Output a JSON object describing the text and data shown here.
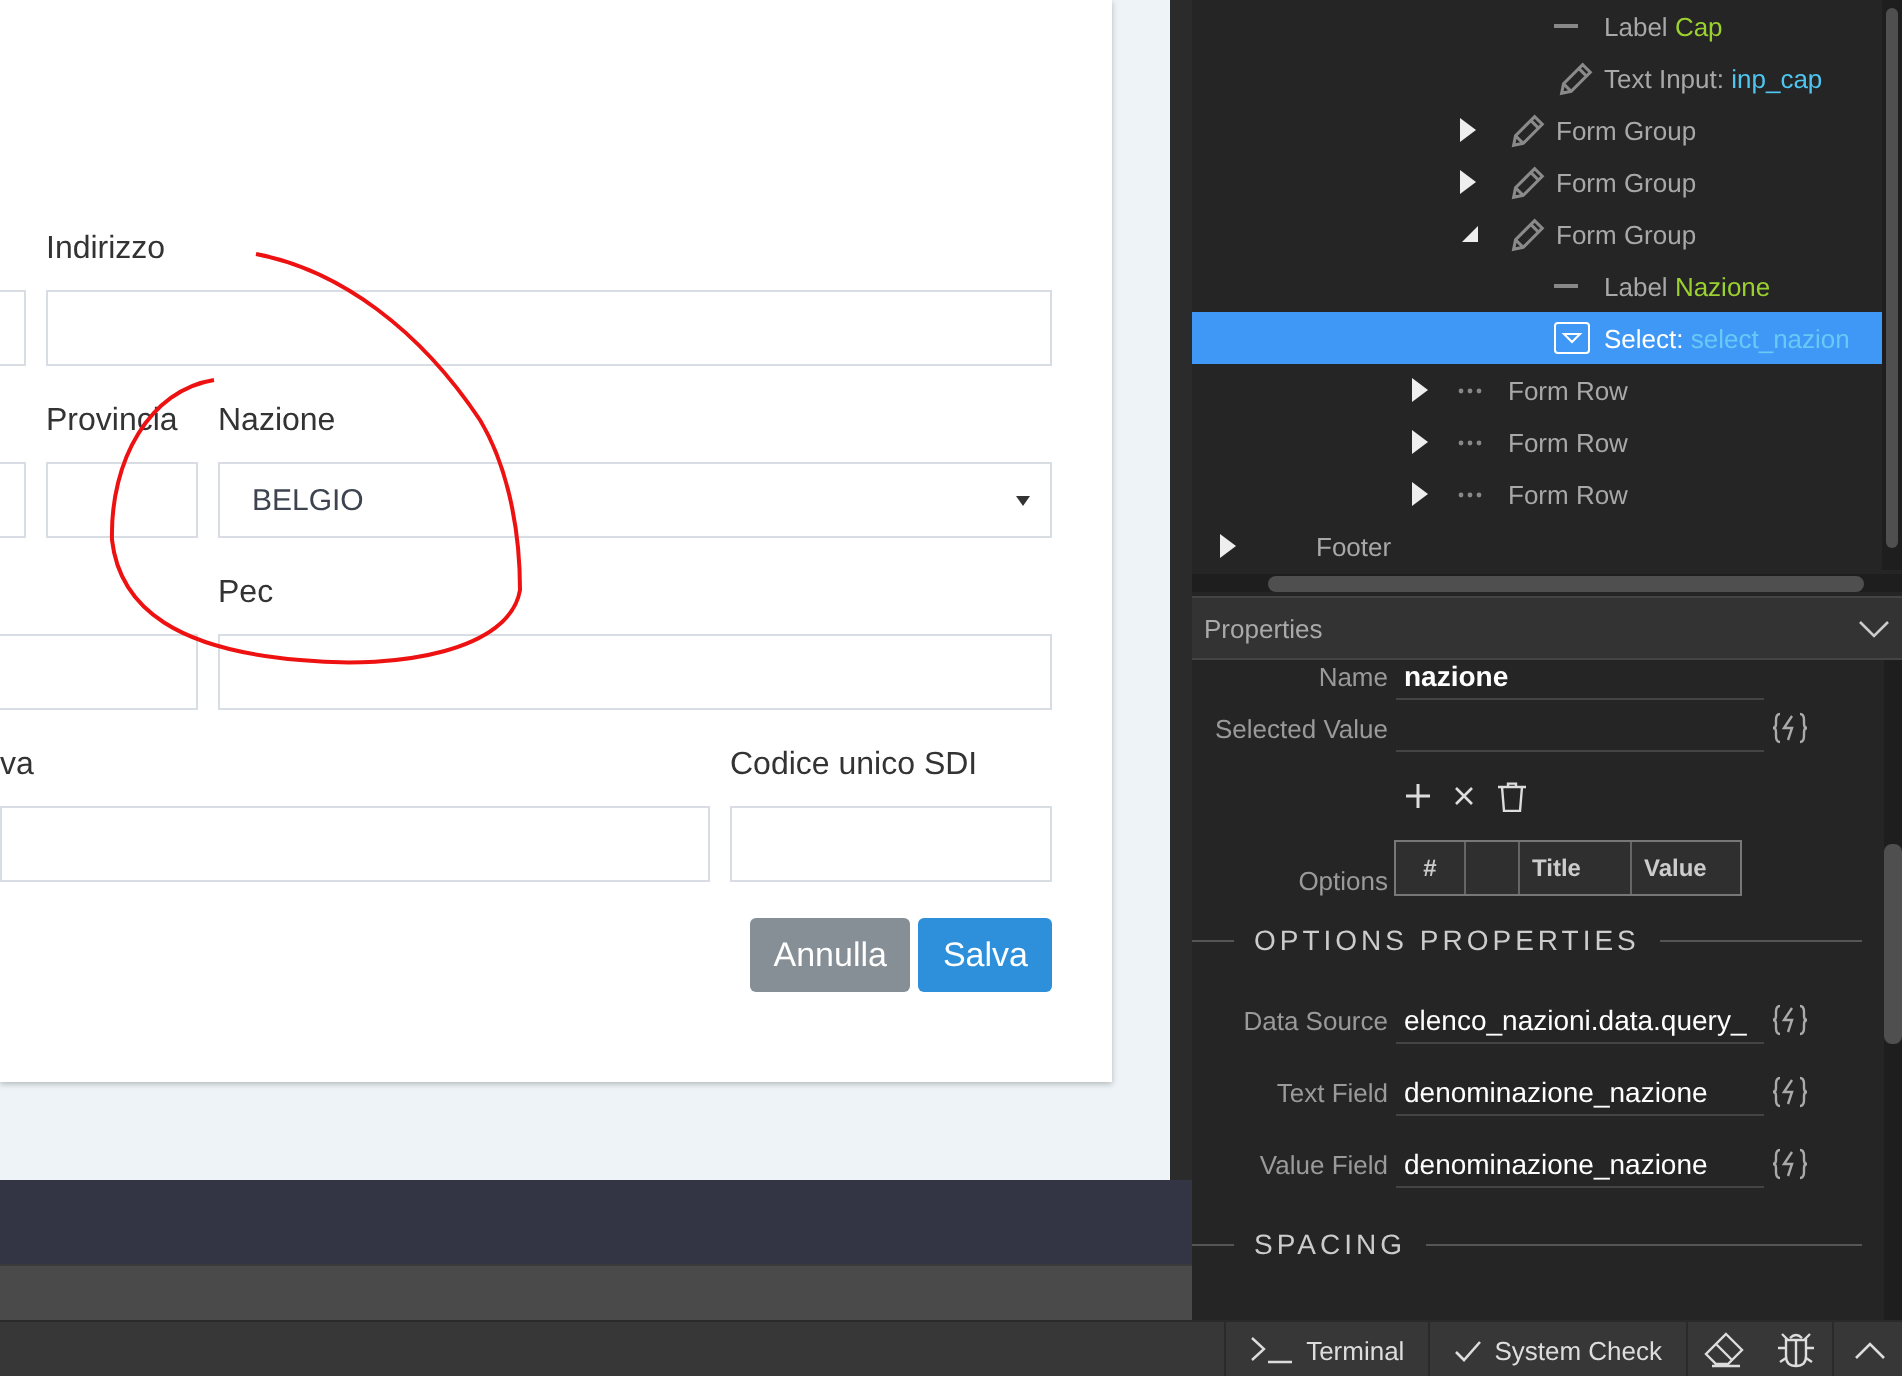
{
  "form": {
    "rows": [
      {
        "fields": [
          {
            "kind": "input"
          },
          {
            "kind": "input",
            "label": "Indirizzo"
          }
        ]
      },
      {
        "fields": [
          {
            "kind": "input"
          },
          {
            "kind": "input",
            "label": "Provincia"
          },
          {
            "kind": "select",
            "label": "Nazione",
            "value": "BELGIO"
          }
        ]
      },
      {
        "fields": [
          {
            "kind": "input"
          },
          {
            "kind": "input",
            "label": "Pec"
          }
        ]
      },
      {
        "fields": [
          {
            "kind": "input",
            "label": "va"
          },
          {
            "kind": "input",
            "label": "Codice unico SDI"
          }
        ]
      }
    ],
    "buttons": [
      {
        "label": "Annulla",
        "kind": "secondary"
      },
      {
        "label": "Salva",
        "kind": "primary"
      }
    ]
  },
  "tree": {
    "items": [
      {
        "children": [
          {
            "children": [
              {
                "children": [
                  {
                    "children": [
                      {
                        "children": [
                          {
                            "children": [
                              {
                                "kind": "label",
                                "text": "Label",
                                "name": "Cap",
                                "selected": false
                              },
                              {
                                "kind": "input",
                                "text": "Text Input:",
                                "name": "inp_cap",
                                "selected": false
                              }
                            ]
                          },
                          {
                            "kind": "group",
                            "text": "Form Group",
                            "expanded": false,
                            "selected": false
                          },
                          {
                            "kind": "group",
                            "text": "Form Group",
                            "expanded": false,
                            "selected": false
                          },
                          {
                            "kind": "group",
                            "text": "Form Group",
                            "expanded": true,
                            "selected": false,
                            "children": [
                              {
                                "kind": "label",
                                "text": "Label",
                                "name": "Nazione",
                                "selected": false
                              },
                              {
                                "kind": "select",
                                "text": "Select:",
                                "name": "select_nazion",
                                "selected": true
                              }
                            ]
                          }
                        ]
                      },
                      {
                        "kind": "row",
                        "text": "Form Row",
                        "expanded": false,
                        "selected": false
                      },
                      {
                        "kind": "row",
                        "text": "Form Row",
                        "expanded": false,
                        "selected": false
                      },
                      {
                        "kind": "row",
                        "text": "Form Row",
                        "expanded": false,
                        "selected": false
                      }
                    ]
                  }
                ]
              }
            ]
          }
        ]
      },
      {
        "text": "Footer",
        "expanded": false,
        "selected": false
      }
    ]
  },
  "properties": {
    "title": "Properties",
    "items": [
      {
        "kind": "field",
        "label": "Name",
        "value": "nazione",
        "binding": false
      },
      {
        "kind": "field",
        "label": "Selected Value",
        "binding": true
      },
      {
        "kind": "options",
        "label": "Options",
        "columns": [
          "#",
          "Title",
          "Value"
        ]
      },
      {
        "kind": "section",
        "label": "OPTIONS PROPERTIES"
      },
      {
        "kind": "field",
        "label": "Data Source",
        "value": "elenco_nazioni.data.query_",
        "binding": true
      },
      {
        "kind": "field",
        "label": "Text Field",
        "value": "denominazione_nazione",
        "binding": true
      },
      {
        "kind": "field",
        "label": "Value Field",
        "value": "denominazione_nazione",
        "binding": true
      },
      {
        "kind": "section",
        "label": "SPACING"
      }
    ]
  },
  "bottom_bar": [
    {
      "kind": "terminal",
      "label": "Terminal"
    },
    {
      "kind": "check",
      "label": "System Check"
    },
    {
      "kind": "eraser"
    },
    {
      "kind": "bug"
    },
    {
      "kind": "collapse"
    }
  ]
}
